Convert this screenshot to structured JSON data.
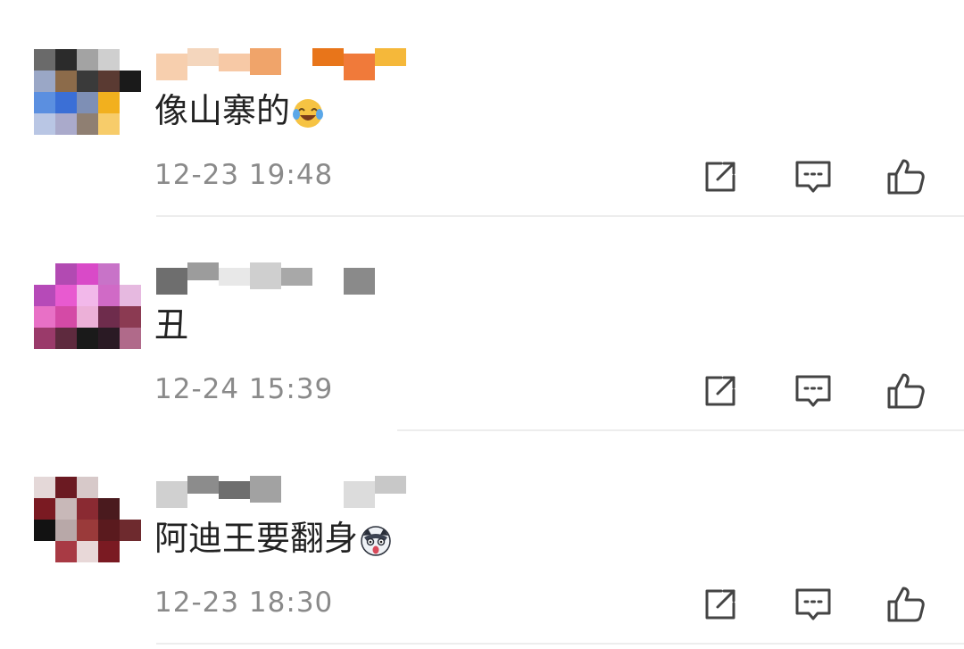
{
  "comments": [
    {
      "text": "像山寨的",
      "emoji_icon": "laugh-cry-emoji-icon",
      "time": "12-23 19:48",
      "avatar_colors": [
        [
          "#6a6a6a",
          "#2b2b2b",
          "#a3a3a3",
          "#cfcfcf",
          "#ffffff"
        ],
        [
          "#9aa7c6",
          "#8c6b4a",
          "#3a3a3a",
          "#5a3a32",
          "#1a1a1a"
        ],
        [
          "#5b8fe0",
          "#3b6fd6",
          "#7e8fb5",
          "#f2b01e",
          "#ffffff"
        ],
        [
          "#b9c6e4",
          "#aaaacb",
          "#8f7f72",
          "#f7cc6a",
          "#ffffff"
        ]
      ],
      "name_colors": [
        "#f7cfae",
        "#f4d6bd",
        "#f7c9a6",
        "#f0a46a",
        "#ffffff",
        "#e8751a",
        "#f07a3a",
        "#f5b83a"
      ]
    },
    {
      "text": "丑",
      "emoji_icon": "",
      "time": "12-24 15:39",
      "avatar_colors": [
        [
          "#ffffff",
          "#b24ab2",
          "#d94ac8",
          "#c873c8",
          "#ffffff"
        ],
        [
          "#b64ab8",
          "#e85ad0",
          "#f2b8ea",
          "#d06ac6",
          "#e6b9e0"
        ],
        [
          "#e870c6",
          "#d44aa6",
          "#ecb0d8",
          "#6e2c4c",
          "#8b3a52"
        ],
        [
          "#9a3a6a",
          "#5e2a3e",
          "#1a1a1a",
          "#2a1a24",
          "#b06a8a"
        ]
      ],
      "name_colors": [
        "#6e6e6e",
        "#9c9c9c",
        "#e8e8e8",
        "#cfcfcf",
        "#a8a8a8",
        "#ffffff",
        "#8a8a8a",
        "#ffffff"
      ]
    },
    {
      "text": "阿迪王要翻身",
      "emoji_icon": "shocked-husky-emoji-icon",
      "time": "12-23 18:30",
      "avatar_colors": [
        [
          "#e4d8d8",
          "#6b1a22",
          "#d7c9c9",
          "#ffffff",
          "#ffffff"
        ],
        [
          "#7a1a22",
          "#c8b8b8",
          "#8a2a32",
          "#4a1a1e",
          "#ffffff"
        ],
        [
          "#121212",
          "#b8a8a8",
          "#9a3a3a",
          "#5a1a1e",
          "#6e2a2e"
        ],
        [
          "#ffffff",
          "#a83a44",
          "#e8d8d8",
          "#7a1a22",
          "#ffffff"
        ]
      ],
      "name_colors": [
        "#d0d0d0",
        "#8c8c8c",
        "#6e6e6e",
        "#a2a2a2",
        "#ffffff",
        "#ffffff",
        "#dcdcdc",
        "#c8c8c8"
      ]
    }
  ],
  "actions": {
    "share_icon": "share-icon",
    "reply_icon": "reply-icon",
    "like_icon": "like-icon"
  },
  "colors": {
    "text": "#222222",
    "time": "#8a8a8a",
    "icon_stroke": "#444444",
    "divider": "#ededed"
  }
}
